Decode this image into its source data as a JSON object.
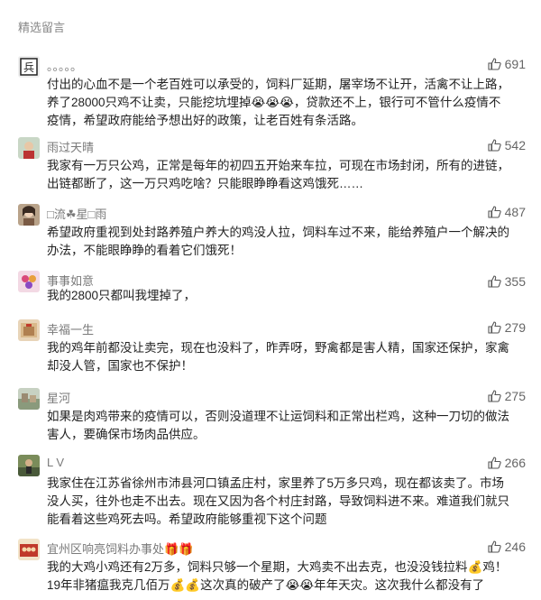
{
  "header": {
    "title": "精选留言"
  },
  "comments": [
    {
      "name": "。。。。。",
      "likes": "691",
      "text_lines": [
        "付出的心血不是一个老百姓可以承受的，饲料厂延期，屠宰场不让开，活禽不让上路，",
        "养了28000只鸡不让卖，只能挖坑埋掉😭😭😭，贷款还不上，银行可不管什么疫情不",
        "疫情，希望政府能给予想出好的政策，让老百姓有条活路。"
      ]
    },
    {
      "name": "雨过天晴",
      "likes": "542",
      "text_lines": [
        "我家有一万只公鸡，正常是每年的初四五开始来车拉，可现在市场封闭，所有的进链，",
        "出链都断了，这一万只鸡吃啥？只能眼睁睁看这鸡饿死……"
      ]
    },
    {
      "name": "□流☘星□雨",
      "likes": "487",
      "text_lines": [
        "希望政府重视到处封路养殖户养大的鸡没人拉，饲料车过不来，能给养殖户一个解决的",
        "办法，不能眼睁睁的看着它们饿死！"
      ]
    },
    {
      "name": "事事如意",
      "likes": "355",
      "text_lines": [
        "我的2800只都叫我埋掉了，"
      ]
    },
    {
      "name": "幸福一生",
      "likes": "279",
      "text_lines": [
        "我的鸡年前都没让卖完，现在也没料了，昨弄呀，野禽都是害人精，国家还保护，家禽",
        "却没人管，国家也不保护！"
      ]
    },
    {
      "name": "星河",
      "likes": "275",
      "text_lines": [
        "如果是肉鸡带来的疫情可以，否则没道理不让运饲料和正常出栏鸡，这种一刀切的做法",
        "害人，要确保市场肉品供应。"
      ]
    },
    {
      "name": "L V",
      "likes": "266",
      "text_lines": [
        "我家住在江苏省徐州市沛县河口镇孟庄村，家里养了5万多只鸡，现在都该卖了。市场",
        "没人买，往外也走不出去。现在又因为各个村庄封路，导致饲料进不来。难道我们就只",
        "能看着这些鸡死去吗。希望政府能够重视下这个问题"
      ]
    },
    {
      "name": "宜州区响亮饲料办事处🎁🎁",
      "likes": "246",
      "text_lines": [
        "我的大鸡小鸡还有2万多，饲料只够一个星期，大鸡卖不出去克，也没没钱拉料💰鸡！",
        "19年非猪瘟我克几佰万💰💰这次真的破产了😭😭年年天灾。这次我什么都没有了"
      ]
    }
  ],
  "colors": {
    "name": "#7a7a7a",
    "text": "#222222",
    "like": "#666666"
  }
}
